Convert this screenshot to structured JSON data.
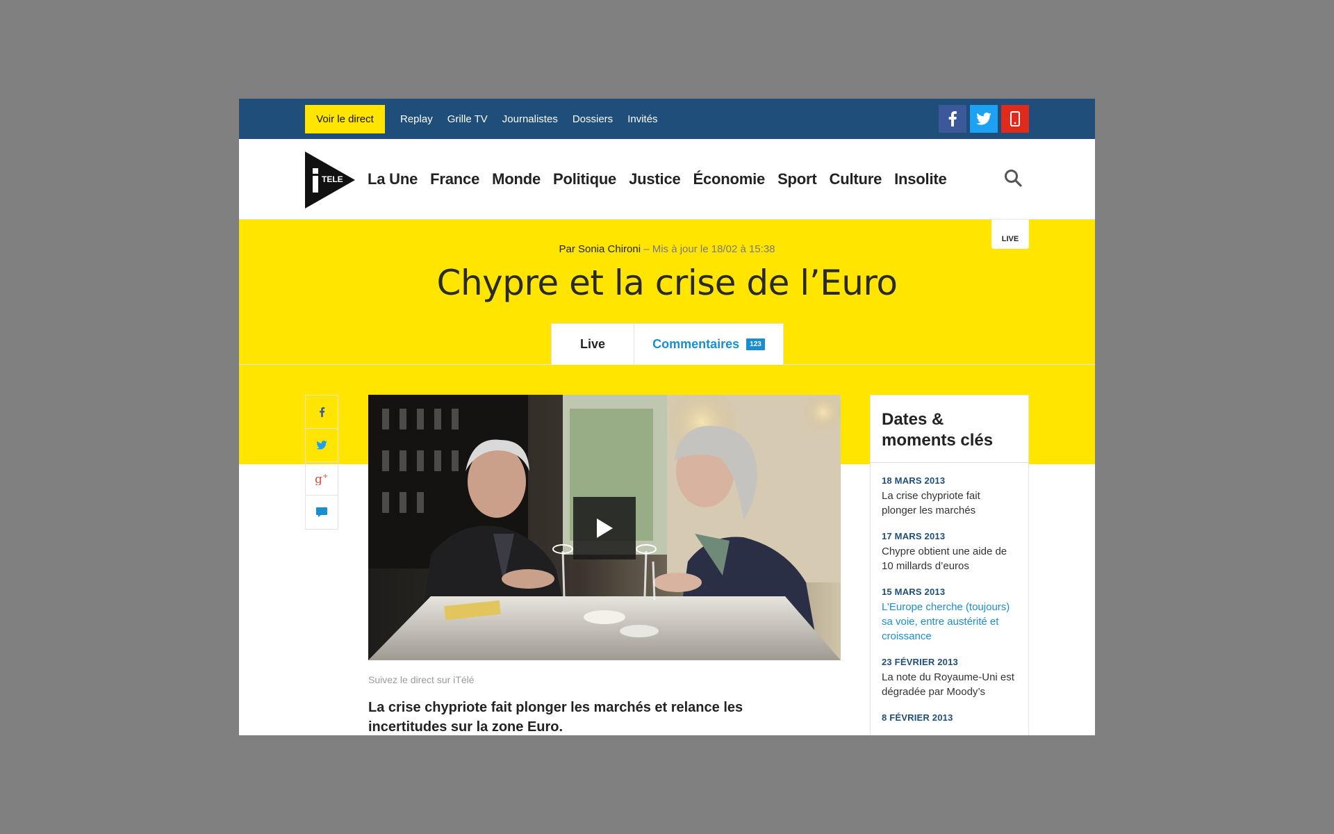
{
  "topbar": {
    "live_button": "Voir le direct",
    "nav": [
      "Replay",
      "Grille TV",
      "Journalistes",
      "Dossiers",
      "Invités"
    ],
    "social": [
      "facebook-icon",
      "twitter-icon",
      "mobile-icon"
    ],
    "colors": {
      "bar": "#1f4e7a",
      "live_button": "#ffe500",
      "facebook": "#3b5998",
      "twitter": "#1da1f2",
      "mobile": "#e02a1c"
    }
  },
  "header": {
    "logo_text": "TELE",
    "nav": [
      "La Une",
      "France",
      "Monde",
      "Politique",
      "Justice",
      "Économie",
      "Sport",
      "Culture",
      "Insolite"
    ]
  },
  "article": {
    "live_tag": "LIVE",
    "author": "Par Sonia Chironi",
    "updated": " – Mis à jour le 18/02 à 15:38",
    "title": "Chypre et la crise de l’Euro",
    "tabs": {
      "live": "Live",
      "comments": "Commentaires",
      "comments_count": "123"
    },
    "caption": "Suivez le direct sur iTélé",
    "lead": "La crise chypriote fait plonger les marchés et relance les incertitudes sur la zone Euro."
  },
  "share": [
    "facebook-icon",
    "twitter-icon",
    "google-plus-icon",
    "comment-icon"
  ],
  "sidebar": {
    "title": "Dates & moments clés",
    "items": [
      {
        "date": "18 MARS 2013",
        "text": "La crise chypriote fait plonger les marchés",
        "link": false
      },
      {
        "date": "17 MARS 2013",
        "text": "Chypre obtient une aide de 10 millards d’euros",
        "link": false
      },
      {
        "date": "15 MARS 2013",
        "text": "L’Europe cherche (toujours) sa voie, entre austérité et croissance",
        "link": true
      },
      {
        "date": "23 FÉVRIER 2013",
        "text": "La note du Royaume-Uni est dégradée par Moody’s",
        "link": false
      },
      {
        "date": "8 FÉVRIER 2013",
        "text": "",
        "link": false
      }
    ]
  }
}
